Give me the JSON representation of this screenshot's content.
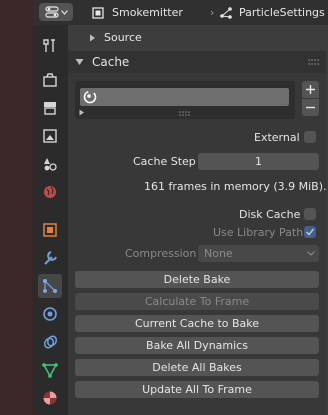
{
  "header": {
    "object_name": "Smokemitter",
    "settings_name": "ParticleSettings"
  },
  "tabs": [
    {
      "icon": "tool-icon"
    },
    {
      "icon": "render-icon"
    },
    {
      "icon": "output-icon"
    },
    {
      "icon": "view-layer-icon"
    },
    {
      "icon": "scene-icon"
    },
    {
      "icon": "world-icon"
    },
    {
      "icon": "object-icon"
    },
    {
      "icon": "modifier-icon"
    },
    {
      "icon": "particles-icon",
      "active": true
    },
    {
      "icon": "physics-icon"
    },
    {
      "icon": "constraints-icon"
    },
    {
      "icon": "data-icon"
    },
    {
      "icon": "material-icon"
    }
  ],
  "source_panel": {
    "label": "Source"
  },
  "cache_panel": {
    "label": "Cache",
    "external_label": "External",
    "cache_step_label": "Cache Step",
    "cache_step_value": "1",
    "frames_info": "161 frames in memory (3.9 MiB).",
    "disk_cache_label": "Disk Cache",
    "use_library_path_label": "Use Library Path",
    "use_library_path_checked": true,
    "compression_label": "Compression",
    "compression_value": "None",
    "buttons": {
      "delete_bake": "Delete Bake",
      "calculate_to_frame": "Calculate To Frame",
      "current_cache_to_bake": "Current Cache to Bake",
      "bake_all_dynamics": "Bake All Dynamics",
      "delete_all_bakes": "Delete All Bakes",
      "update_all_to_frame": "Update All To Frame"
    }
  },
  "colors": {
    "accent_blue": "#4772b3",
    "tab_active_bg": "#474747"
  }
}
